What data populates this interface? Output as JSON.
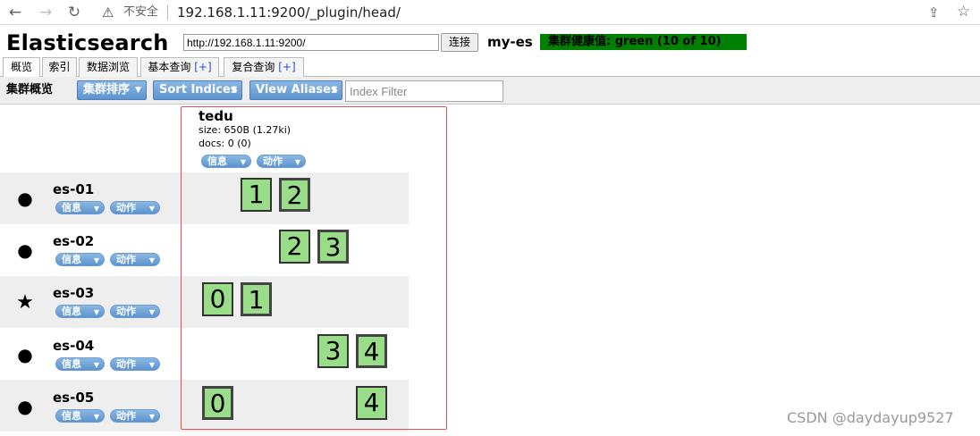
{
  "browser": {
    "insecure_label": "不安全",
    "url": "192.168.1.11:9200/_plugin/head/"
  },
  "header": {
    "brand": "Elasticsearch",
    "connect_url": "http://192.168.1.11:9200/",
    "connect_label": "连接",
    "cluster_name": "my-es",
    "health": "集群健康值: green (10 of 10)",
    "health_color": "#008000"
  },
  "tabs": [
    {
      "label": "概览"
    },
    {
      "label": "索引"
    },
    {
      "label": "数据浏览"
    },
    {
      "label": "基本查询",
      "plus": "[+]"
    },
    {
      "label": "复合查询",
      "plus": "[+]"
    }
  ],
  "toolbar": {
    "title": "集群概览",
    "sort_cluster": "集群排序",
    "sort_indices": "Sort Indices",
    "view_aliases": "View Aliases",
    "index_filter_placeholder": "Index Filter"
  },
  "index": {
    "name": "tedu",
    "size": "size: 650B (1.27ki)",
    "docs": "docs: 0 (0)",
    "info_label": "信息",
    "action_label": "动作"
  },
  "nodes": [
    {
      "name": "es-01",
      "icon": "circle-icon",
      "info": "信息",
      "action": "动作",
      "shards": [
        "1",
        "2"
      ]
    },
    {
      "name": "es-02",
      "icon": "circle-icon",
      "info": "信息",
      "action": "动作",
      "shards": [
        "2",
        "3"
      ]
    },
    {
      "name": "es-03",
      "icon": "star-icon",
      "info": "信息",
      "action": "动作",
      "shards": [
        "0",
        "1"
      ]
    },
    {
      "name": "es-04",
      "icon": "circle-icon",
      "info": "信息",
      "action": "动作",
      "shards": [
        "3",
        "4"
      ]
    },
    {
      "name": "es-05",
      "icon": "circle-icon",
      "info": "信息",
      "action": "动作",
      "shards": [
        "0",
        "4"
      ]
    }
  ],
  "watermark": "CSDN @daydayup9527"
}
